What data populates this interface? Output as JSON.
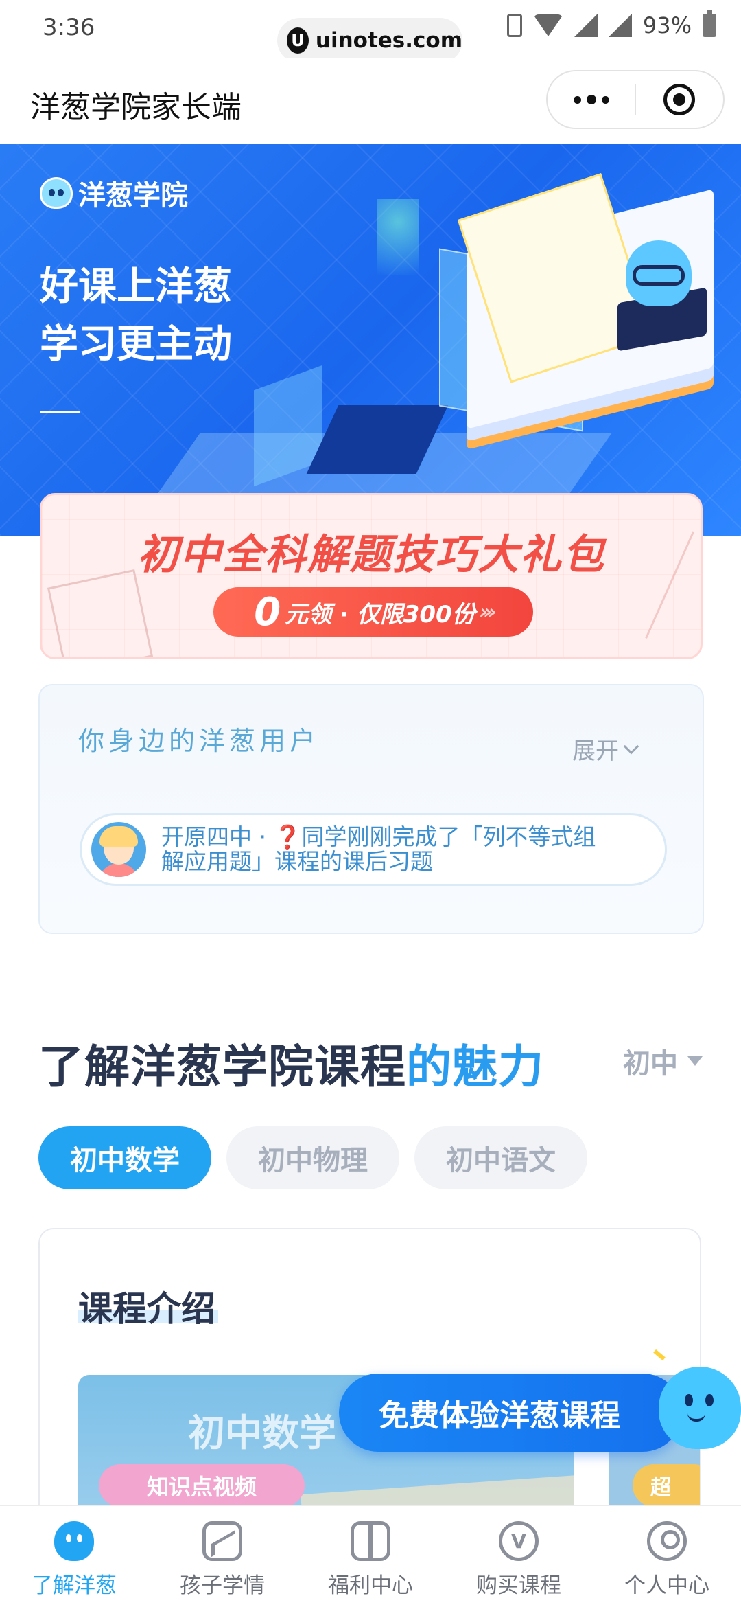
{
  "status_bar": {
    "time": "3:36",
    "url": "uinotes.com",
    "battery": "93%"
  },
  "nav": {
    "title": "洋葱学院家长端"
  },
  "hero": {
    "logo_text": "洋葱学院",
    "slogan_line1": "好课上洋葱",
    "slogan_line2": "学习更主动"
  },
  "promo": {
    "title": "初中全科解题技巧大礼包",
    "zero": "0",
    "button_text": "元领 · 仅限300份",
    "chevrons": "›››"
  },
  "users": {
    "title": "你身边的洋葱用户",
    "expand_label": "展开",
    "notification": "开原四中 · ❓同学刚刚完成了「列不等式组解应用题」课程的课后习题"
  },
  "section": {
    "title_main": "了解洋葱学院课程",
    "title_accent": "的魅力",
    "grade": "初中"
  },
  "tabs": [
    {
      "label": "初中数学",
      "active": true
    },
    {
      "label": "初中物理",
      "active": false
    },
    {
      "label": "初中语文",
      "active": false
    }
  ],
  "course": {
    "intro_title": "课程介绍",
    "thumb_title": "初中数学",
    "thumb_tag": "知识点视频",
    "thumb2_tag": "超"
  },
  "cta": {
    "label": "免费体验洋葱课程"
  },
  "tabbar": [
    {
      "label": "了解洋葱",
      "icon": "onion-mascot-icon",
      "active": true
    },
    {
      "label": "孩子学情",
      "icon": "chart-icon",
      "active": false
    },
    {
      "label": "福利中心",
      "icon": "gift-icon",
      "active": false
    },
    {
      "label": "购买课程",
      "icon": "v-badge-icon",
      "active": false
    },
    {
      "label": "个人中心",
      "icon": "person-icon",
      "active": false
    }
  ],
  "colors": {
    "brand_blue": "#23a4f2",
    "promo_red": "#f24f47",
    "hero_blue": "#1a67ee"
  }
}
